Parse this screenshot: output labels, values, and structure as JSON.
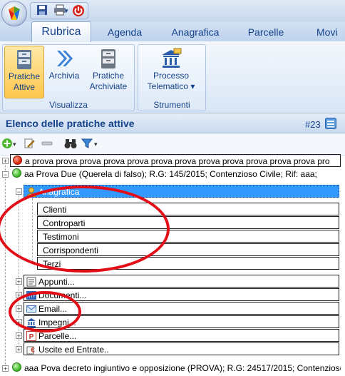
{
  "tabs": [
    "Rubrica",
    "Agenda",
    "Anagrafica",
    "Parcelle",
    "Movi"
  ],
  "ribbon": {
    "visualizza": {
      "label": "Visualizza",
      "buttons": [
        {
          "line1": "Pratiche",
          "line2": "Attive"
        },
        {
          "line1": "Archivia",
          "line2": ""
        },
        {
          "line1": "Pratiche",
          "line2": "Archiviate"
        }
      ]
    },
    "strumenti": {
      "label": "Strumenti",
      "button": {
        "line1": "Processo",
        "line2": "Telematico ▾"
      }
    }
  },
  "panel": {
    "title": "Elenco delle pratiche attive",
    "count": "#23"
  },
  "tree": {
    "rows": [
      "a prova prova prova prova prova prova prova prova prova prova prova prova pro",
      "aa Prova Due (Querela di falso); R.G: 145/2015; Contenzioso Civile; Rif: aaa;",
      "Anagrafica",
      "Clienti",
      "Controparti",
      "Testimoni",
      "Corrispondenti",
      "Terzi",
      "Appunti...",
      "Documenti...",
      "Email...",
      "Impegni...",
      "Parcelle...",
      "Uscite ed Entrate..",
      "aaa Pova decreto ingiuntivo e opposizione (PROVA); R.G: 24517/2015; Contenzioso C"
    ]
  },
  "colors": {
    "accent": "#15428b",
    "selection": "#3399ff",
    "annotation": "#e20e17"
  },
  "icons": [
    "office-orb-icon",
    "save-icon",
    "print-icon",
    "power-icon",
    "pratiche-attive-icon",
    "archivia-icon",
    "pratiche-archiviate-icon",
    "processo-telematico-icon",
    "list-icon",
    "add-icon",
    "edit-icon",
    "remove-icon",
    "binoculars-icon",
    "filter-icon"
  ]
}
